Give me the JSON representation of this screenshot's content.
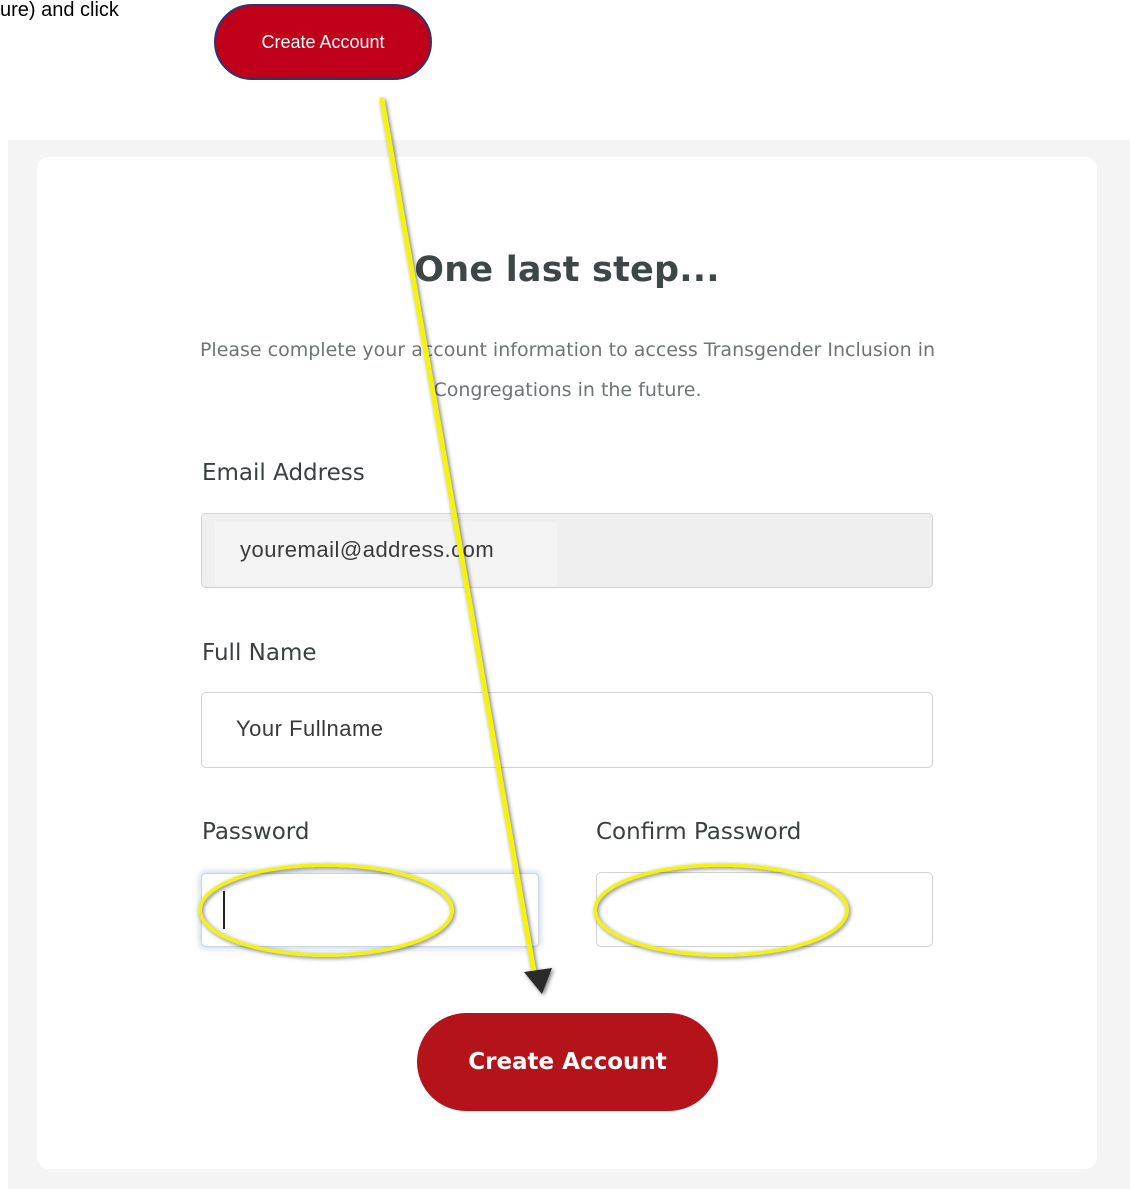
{
  "instruction": {
    "text": "ure) and click"
  },
  "callout": {
    "label": "Create Account"
  },
  "form": {
    "title": "One last step...",
    "subtitle_line1": "Please complete your account information to access Transgender Inclusion in",
    "subtitle_line2": "Congregations in the future.",
    "email": {
      "label": "Email Address",
      "value": "youremail@address.com"
    },
    "fullname": {
      "label": "Full Name",
      "value": "Your Fullname"
    },
    "password": {
      "label": "Password",
      "value": ""
    },
    "confirm_password": {
      "label": "Confirm Password",
      "value": ""
    },
    "submit_label": "Create Account"
  },
  "colors": {
    "brand_red": "#b5131a",
    "callout_red": "#c0001a",
    "annotation_yellow": "#f5f20a"
  }
}
